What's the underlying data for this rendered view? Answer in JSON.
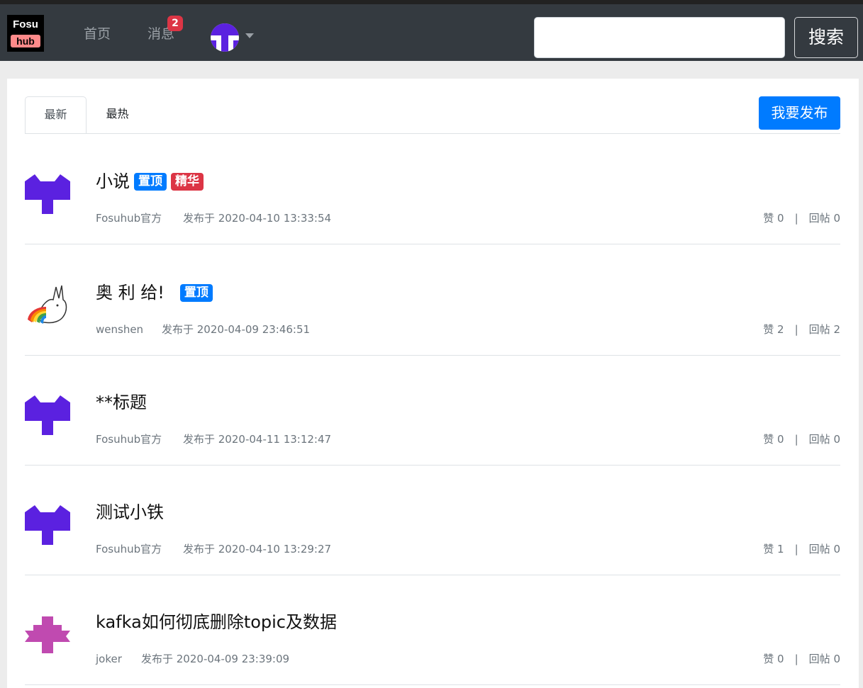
{
  "navbar": {
    "logo_top": "Fosu",
    "logo_bottom": "hub",
    "home": "首页",
    "messages": "消息",
    "message_count": "2",
    "search_placeholder": "",
    "search_button": "搜索"
  },
  "tabs": {
    "latest": "最新",
    "hottest": "最热"
  },
  "publish_button": "我要发布",
  "like_label": "赞",
  "reply_label": "回帖",
  "stat_separator": "|",
  "posts": [
    {
      "title": "小说",
      "tag_top": "置顶",
      "tag_best": "精华",
      "author": "Fosuhub官方",
      "date": "发布于 2020-04-10 13:33:54",
      "likes": "0",
      "replies": "0"
    },
    {
      "title": "奥 利 给!",
      "tag_top": "置顶",
      "author": "wenshen",
      "date": "发布于 2020-04-09 23:46:51",
      "likes": "2",
      "replies": "2"
    },
    {
      "title": "**标题",
      "author": "Fosuhub官方",
      "date": "发布于 2020-04-11 13:12:47",
      "likes": "0",
      "replies": "0"
    },
    {
      "title": "测试小铁",
      "author": "Fosuhub官方",
      "date": "发布于 2020-04-10 13:29:27",
      "likes": "1",
      "replies": "0"
    },
    {
      "title": "kafka如何彻底删除topic及数据",
      "author": "joker",
      "date": "发布于 2020-04-09 23:39:09",
      "likes": "0",
      "replies": "0"
    }
  ],
  "colors": {
    "navbar": "#343a40",
    "primary": "#007bff",
    "danger": "#dc3545",
    "identicon_purple": "#5b21e0",
    "identicon_magenta": "#c04ab0"
  }
}
